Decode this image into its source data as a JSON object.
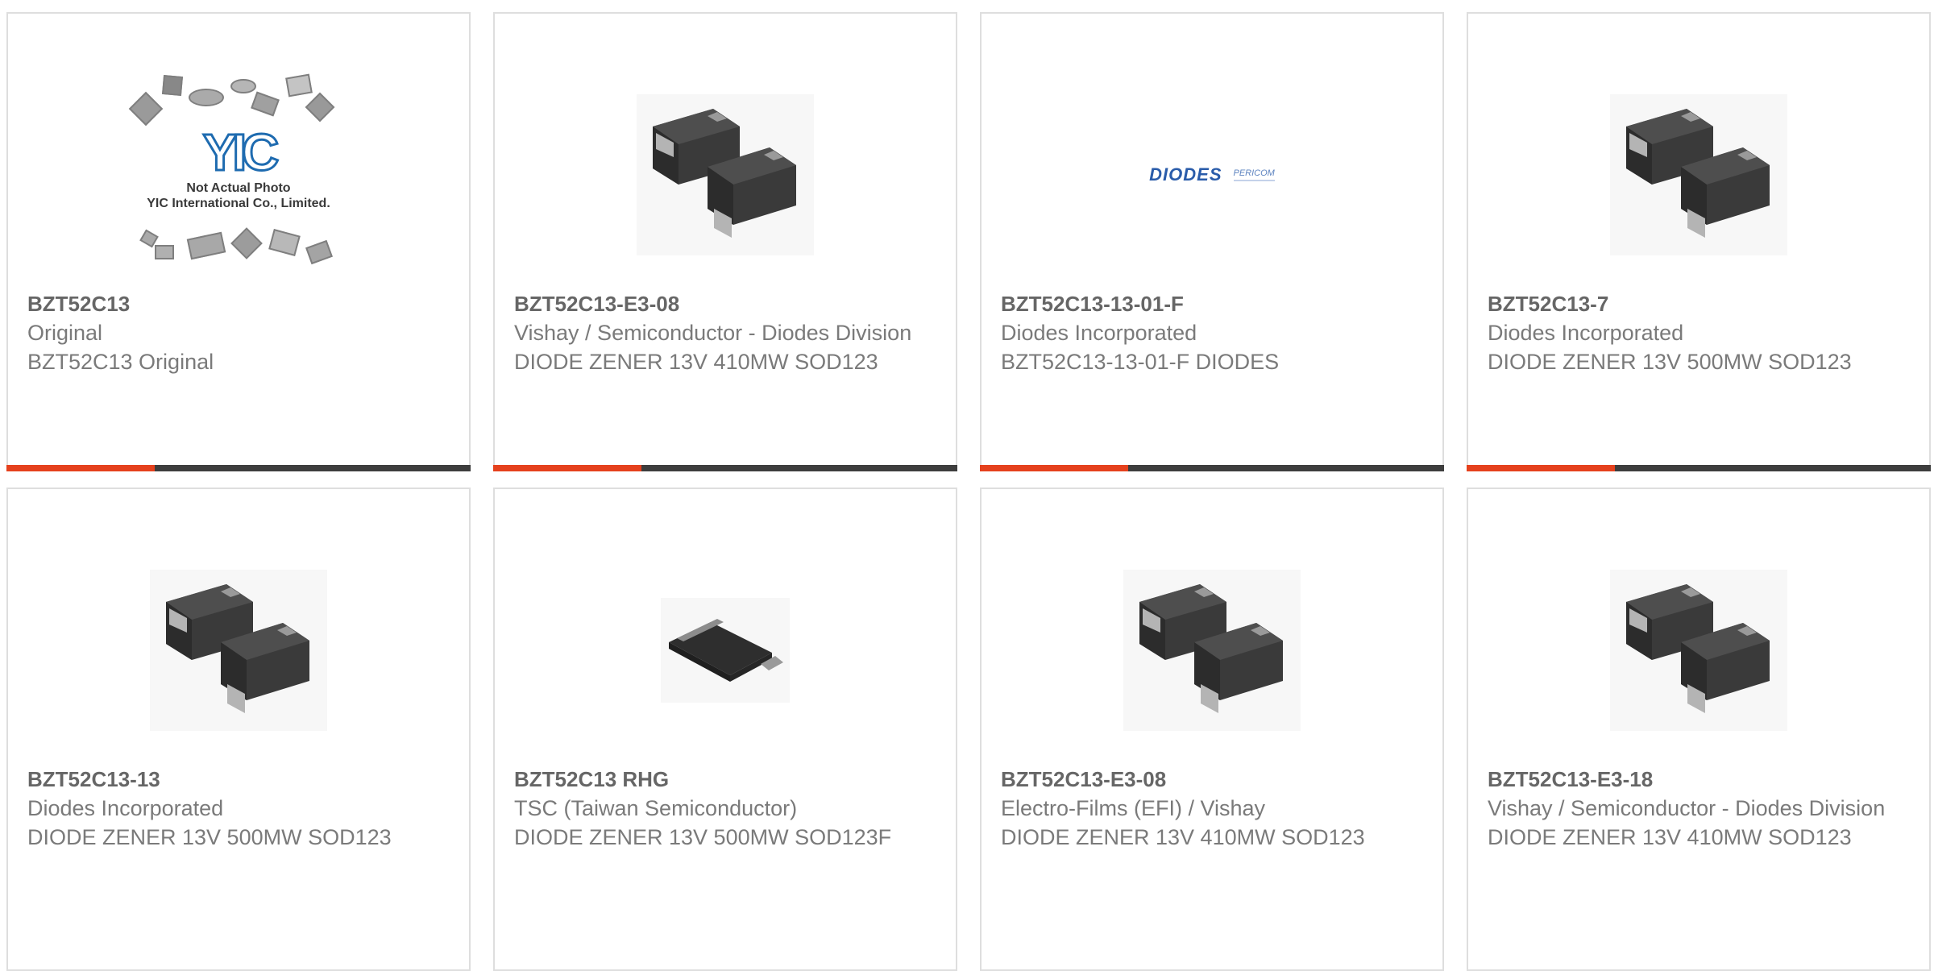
{
  "cards": [
    {
      "part_number": "BZT52C13",
      "manufacturer": "Original",
      "description": "BZT52C13 Original",
      "image": "not-actual-photo-placeholder",
      "placeholder_line1": "Not Actual Photo",
      "placeholder_line2": "YIC International Co., Limited.",
      "placeholder_logo": "YIC"
    },
    {
      "part_number": "BZT52C13-E3-08",
      "manufacturer": "Vishay / Semiconductor - Diodes Division",
      "description": "DIODE ZENER 13V 410MW SOD123",
      "image": "sod123-package-pair"
    },
    {
      "part_number": "BZT52C13-13-01-F",
      "manufacturer": "Diodes Incorporated",
      "description": "BZT52C13-13-01-F DIODES",
      "image": "diodes-pericom-logo",
      "logo_text_1": "DIODES",
      "logo_text_2": "PERICOM"
    },
    {
      "part_number": "BZT52C13-7",
      "manufacturer": "Diodes Incorporated",
      "description": "DIODE ZENER 13V 500MW SOD123",
      "image": "sod123-package-pair"
    },
    {
      "part_number": "BZT52C13-13",
      "manufacturer": "Diodes Incorporated",
      "description": "DIODE ZENER 13V 500MW SOD123",
      "image": "sod123-package-pair"
    },
    {
      "part_number": "BZT52C13 RHG",
      "manufacturer": "TSC (Taiwan Semiconductor)",
      "description": "DIODE ZENER 13V 500MW SOD123F",
      "image": "sod123f-package"
    },
    {
      "part_number": "BZT52C13-E3-08",
      "manufacturer": "Electro-Films (EFI) / Vishay",
      "description": "DIODE ZENER 13V 410MW SOD123",
      "image": "sod123-package-pair"
    },
    {
      "part_number": "BZT52C13-E3-18",
      "manufacturer": "Vishay / Semiconductor - Diodes Division",
      "description": "DIODE ZENER 13V 410MW SOD123",
      "image": "sod123-package-pair"
    }
  ],
  "colors": {
    "accent": "#e5411d",
    "bar": "#3d3d3d",
    "border": "#dedede",
    "title_text": "#666666",
    "body_text": "#7a7a7a"
  }
}
